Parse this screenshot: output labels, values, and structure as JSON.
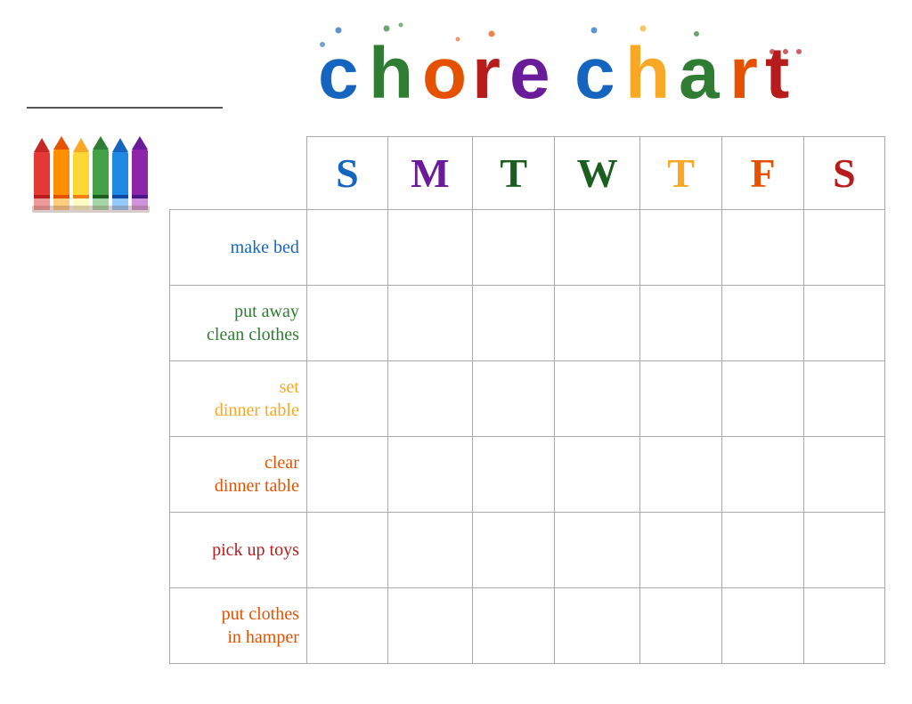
{
  "header": {
    "title_word1": "chore",
    "title_word2": "chart",
    "name_line_label": "Name line"
  },
  "days": {
    "headers": [
      {
        "label": "S",
        "color_class": "day-S1"
      },
      {
        "label": "M",
        "color_class": "day-M"
      },
      {
        "label": "T",
        "color_class": "day-T1"
      },
      {
        "label": "W",
        "color_class": "day-W"
      },
      {
        "label": "T",
        "color_class": "day-T2"
      },
      {
        "label": "F",
        "color_class": "day-F"
      },
      {
        "label": "S",
        "color_class": "day-S2"
      }
    ]
  },
  "chores": [
    {
      "label": "make bed",
      "color_class": "chore-make-bed",
      "multiline": false
    },
    {
      "label": "put away\nclean clothes",
      "color_class": "chore-put-away",
      "multiline": true
    },
    {
      "label": "set\ndinner table",
      "color_class": "chore-set-dinner",
      "multiline": true
    },
    {
      "label": "clear\ndinner table",
      "color_class": "chore-clear-dinner",
      "multiline": true
    },
    {
      "label": "pick up toys",
      "color_class": "chore-pick-up",
      "multiline": false
    },
    {
      "label": "put clothes\nin hamper",
      "color_class": "chore-put-clothes",
      "multiline": true
    }
  ],
  "crayons": {
    "colors": [
      "#E53935",
      "#FF8F00",
      "#FDD835",
      "#43A047",
      "#1E88E5",
      "#8E24AA"
    ]
  }
}
